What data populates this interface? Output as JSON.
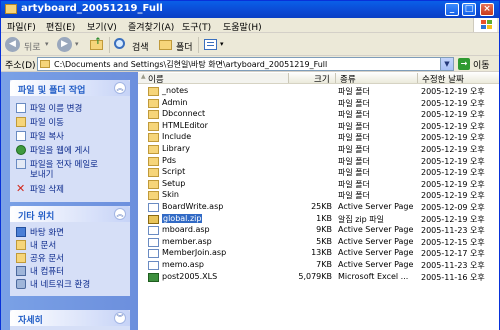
{
  "window": {
    "title": "artyboard_20051219_Full"
  },
  "menu": [
    "파일(F)",
    "편집(E)",
    "보기(V)",
    "즐겨찾기(A)",
    "도구(T)",
    "도움말(H)"
  ],
  "toolbar": {
    "back": "뒤로",
    "search": "검색",
    "folders": "폴더"
  },
  "address": {
    "label": "주소(D)",
    "value": "C:\\Documents and Settings\\김현일\\바탕 화면\\artyboard_20051219_Full",
    "go": "이동"
  },
  "panels": {
    "file_tasks": {
      "title": "파일 및 폴더 작업",
      "items": [
        "파일 이름 변경",
        "파일 이동",
        "파일 복사",
        "파일을 웹에 게시",
        "파일을 전자 메일로",
        "보내기",
        "파일 삭제"
      ]
    },
    "other_places": {
      "title": "기타 위치",
      "items": [
        "바탕 화면",
        "내 문서",
        "공유 문서",
        "내 컴퓨터",
        "내 네트워크 환경"
      ]
    },
    "details": {
      "title": "자세히"
    }
  },
  "columns": {
    "name": "이름",
    "size": "크기",
    "type": "종류",
    "modified": "수정한 날짜"
  },
  "files": [
    {
      "name": "_notes",
      "size": "",
      "type": "파일 폴더",
      "date": "2005-12-19 오후",
      "kind": "folder"
    },
    {
      "name": "Admin",
      "size": "",
      "type": "파일 폴더",
      "date": "2005-12-19 오후",
      "kind": "folder"
    },
    {
      "name": "Dbconnect",
      "size": "",
      "type": "파일 폴더",
      "date": "2005-12-19 오후",
      "kind": "folder"
    },
    {
      "name": "HTMLEditor",
      "size": "",
      "type": "파일 폴더",
      "date": "2005-12-19 오후",
      "kind": "folder"
    },
    {
      "name": "Include",
      "size": "",
      "type": "파일 폴더",
      "date": "2005-12-19 오후",
      "kind": "folder"
    },
    {
      "name": "Library",
      "size": "",
      "type": "파일 폴더",
      "date": "2005-12-19 오후",
      "kind": "folder"
    },
    {
      "name": "Pds",
      "size": "",
      "type": "파일 폴더",
      "date": "2005-12-19 오후",
      "kind": "folder"
    },
    {
      "name": "Script",
      "size": "",
      "type": "파일 폴더",
      "date": "2005-12-19 오후",
      "kind": "folder"
    },
    {
      "name": "Setup",
      "size": "",
      "type": "파일 폴더",
      "date": "2005-12-19 오후",
      "kind": "folder"
    },
    {
      "name": "Skin",
      "size": "",
      "type": "파일 폴더",
      "date": "2005-12-19 오후",
      "kind": "folder"
    },
    {
      "name": "BoardWrite.asp",
      "size": "25KB",
      "type": "Active Server Page",
      "date": "2005-12-09 오후",
      "kind": "asp"
    },
    {
      "name": "global.zip",
      "size": "1KB",
      "type": "알집 zip 파일",
      "date": "2005-12-19 오후",
      "kind": "zip",
      "selected": true
    },
    {
      "name": "mboard.asp",
      "size": "9KB",
      "type": "Active Server Page",
      "date": "2005-11-23 오후",
      "kind": "asp"
    },
    {
      "name": "member.asp",
      "size": "5KB",
      "type": "Active Server Page",
      "date": "2005-12-15 오후",
      "kind": "asp"
    },
    {
      "name": "MemberJoin.asp",
      "size": "13KB",
      "type": "Active Server Page",
      "date": "2005-12-17 오후",
      "kind": "asp"
    },
    {
      "name": "memo.asp",
      "size": "7KB",
      "type": "Active Server Page",
      "date": "2005-11-23 오후",
      "kind": "asp"
    },
    {
      "name": "post2005.XLS",
      "size": "5,079KB",
      "type": "Microsoft Excel ...",
      "date": "2005-11-16 오후",
      "kind": "xls"
    }
  ]
}
